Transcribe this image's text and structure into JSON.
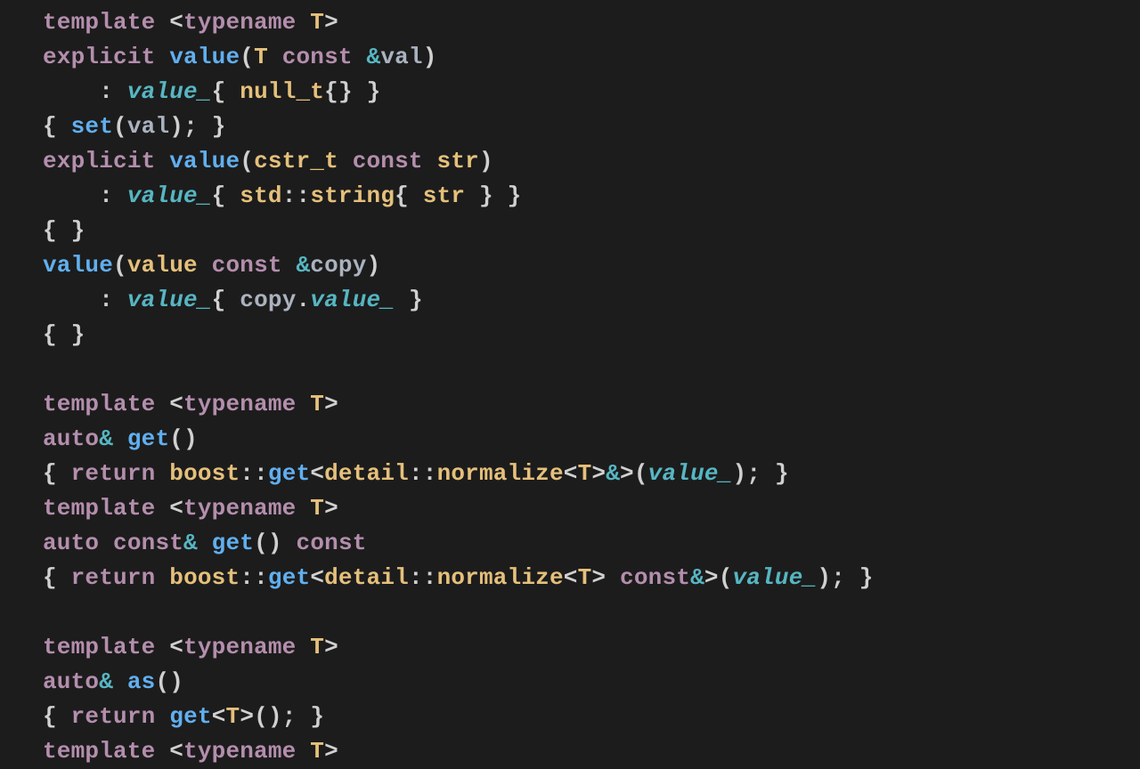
{
  "tokens": {
    "template": "template",
    "typename": "typename",
    "T": "T",
    "explicit": "explicit",
    "value": "value",
    "const": "const",
    "val": "val",
    "value_": "value_",
    "null_t": "null_t",
    "set": "set",
    "cstr_t": "cstr_t",
    "str": "str",
    "std": "std",
    "string": "string",
    "copy": "copy",
    "auto": "auto",
    "get": "get",
    "return": "return",
    "boost": "boost",
    "detail": "detail",
    "normalize": "normalize",
    "as": "as"
  },
  "punct": {
    "lt": "<",
    "gt": ">",
    "lparen": "(",
    "rparen": ")",
    "lbrace": "{",
    "rbrace": "}",
    "colon": ":",
    "dcolon": "::",
    "semi": ";",
    "comma": ",",
    "amp": "&",
    "dot": ".",
    "sp": " ",
    "sp2": "  ",
    "sp4": "    "
  }
}
